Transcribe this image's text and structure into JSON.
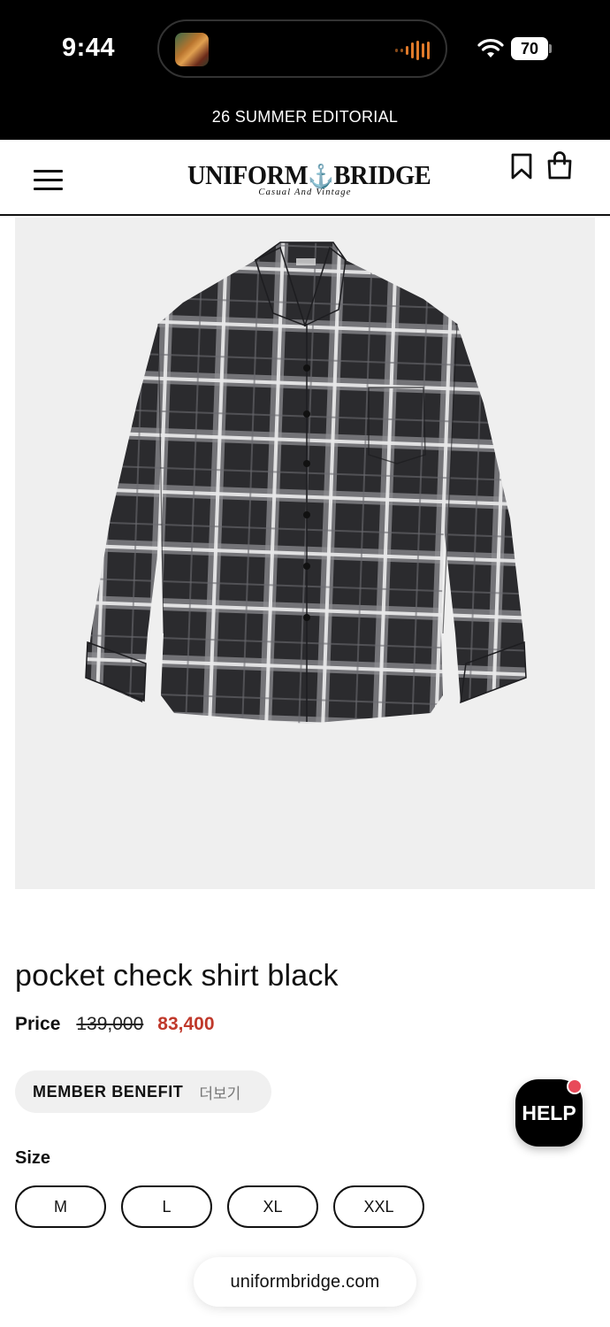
{
  "status_bar": {
    "time": "9:44",
    "battery": "70"
  },
  "announcement": "26 SUMMER EDITORIAL",
  "header": {
    "logo_main_left": "UNIFORM",
    "logo_anchor": "⚓",
    "logo_main_right": "BRIDGE",
    "logo_sub": "Casual And Vintage"
  },
  "product": {
    "title": "pocket check shirt black",
    "price_label": "Price",
    "price_original": "139,000",
    "price_sale": "83,400",
    "shirt_colors": {
      "dark": "#2b2b2e",
      "light": "#e6e6e8",
      "mid": "#8a8a8e"
    }
  },
  "benefit": {
    "label": "MEMBER BENEFIT",
    "more": "더보기"
  },
  "size": {
    "label": "Size",
    "options": [
      "M",
      "L",
      "XL",
      "XXL"
    ]
  },
  "help": {
    "label": "HELP"
  },
  "url": "uniformbridge.com",
  "colors": {
    "sale": "#c0392b",
    "help_dot": "#e84a5a",
    "image_bg": "#efefef"
  }
}
